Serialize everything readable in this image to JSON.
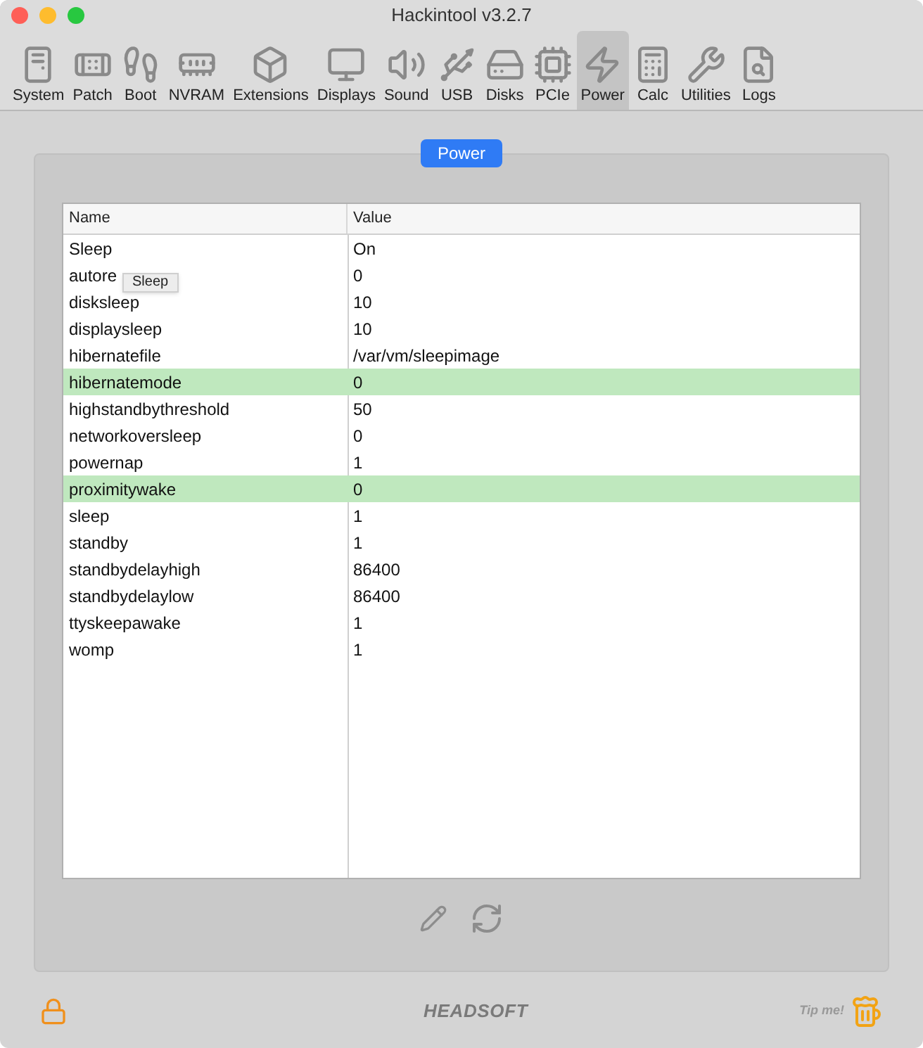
{
  "window": {
    "title": "Hackintool v3.2.7"
  },
  "toolbar": [
    {
      "label": "System",
      "kind": "system",
      "selected": false
    },
    {
      "label": "Patch",
      "kind": "patch",
      "selected": false
    },
    {
      "label": "Boot",
      "kind": "boot",
      "selected": false
    },
    {
      "label": "NVRAM",
      "kind": "nvram",
      "selected": false
    },
    {
      "label": "Extensions",
      "kind": "extensions",
      "selected": false
    },
    {
      "label": "Displays",
      "kind": "displays",
      "selected": false
    },
    {
      "label": "Sound",
      "kind": "sound",
      "selected": false
    },
    {
      "label": "USB",
      "kind": "usb",
      "selected": false
    },
    {
      "label": "Disks",
      "kind": "disks",
      "selected": false
    },
    {
      "label": "PCIe",
      "kind": "pcie",
      "selected": false
    },
    {
      "label": "Power",
      "kind": "power",
      "selected": true
    },
    {
      "label": "Calc",
      "kind": "calc",
      "selected": false
    },
    {
      "label": "Utilities",
      "kind": "utilities",
      "selected": false
    },
    {
      "label": "Logs",
      "kind": "logs",
      "selected": false
    }
  ],
  "section_tab": "Power",
  "table": {
    "columns": [
      "Name",
      "Value"
    ],
    "rows": [
      {
        "name": "Sleep",
        "value": "On",
        "highlighted": false
      },
      {
        "name": "autore",
        "value": "0",
        "highlighted": false
      },
      {
        "name": "disksleep",
        "value": "10",
        "highlighted": false
      },
      {
        "name": "displaysleep",
        "value": "10",
        "highlighted": false
      },
      {
        "name": "hibernatefile",
        "value": "/var/vm/sleepimage",
        "highlighted": false
      },
      {
        "name": "hibernatemode",
        "value": "0",
        "highlighted": true
      },
      {
        "name": "highstandbythreshold",
        "value": "50",
        "highlighted": false
      },
      {
        "name": "networkoversleep",
        "value": "0",
        "highlighted": false
      },
      {
        "name": "powernap",
        "value": "1",
        "highlighted": false
      },
      {
        "name": "proximitywake",
        "value": "0",
        "highlighted": true
      },
      {
        "name": "sleep",
        "value": "1",
        "highlighted": false
      },
      {
        "name": "standby",
        "value": "1",
        "highlighted": false
      },
      {
        "name": "standbydelayhigh",
        "value": "86400",
        "highlighted": false
      },
      {
        "name": "standbydelaylow",
        "value": "86400",
        "highlighted": false
      },
      {
        "name": "ttyskeepawake",
        "value": "1",
        "highlighted": false
      },
      {
        "name": "womp",
        "value": "1",
        "highlighted": false
      }
    ]
  },
  "tooltip": "Sleep",
  "footer": {
    "logo": "HEADSOFT",
    "tip": "Tip me!"
  }
}
